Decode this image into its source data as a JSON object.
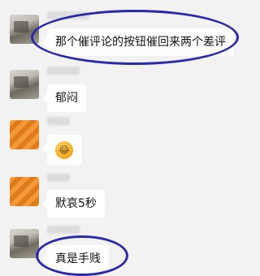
{
  "chat": {
    "messages": [
      {
        "avatar": "avatar-photo",
        "text": "那个催评论的按钮催回来两个差评"
      },
      {
        "avatar": "avatar-photo",
        "text": "郁闷"
      },
      {
        "avatar": "avatar-orange",
        "emoji": "crying-laughing-emoji",
        "emoji_glyph": "😂"
      },
      {
        "avatar": "avatar-orange",
        "text": "默哀5秒"
      },
      {
        "avatar": "avatar-photo",
        "text": "真是手贱"
      }
    ]
  },
  "annotation_color": "#2a2aa8"
}
